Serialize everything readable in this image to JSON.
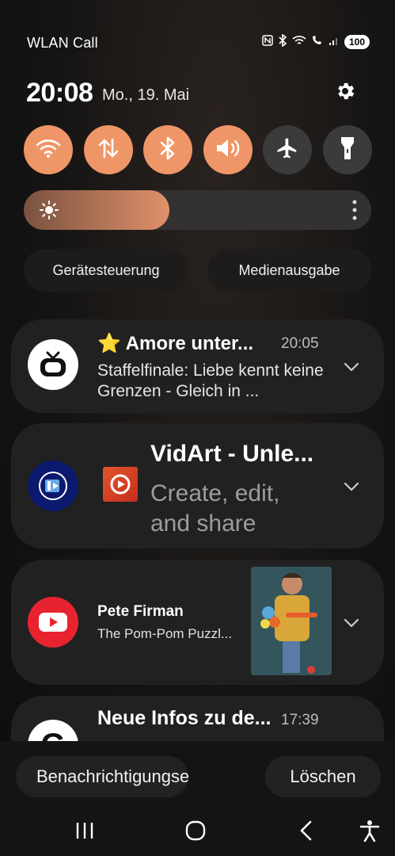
{
  "status_bar": {
    "carrier": "WLAN Call",
    "battery": "100",
    "icons": [
      "nfc-icon",
      "bluetooth-icon",
      "wifi-icon",
      "wifi-call-icon",
      "signal-icon",
      "battery-icon"
    ]
  },
  "header": {
    "time": "20:08",
    "date": "Mo., 19. Mai"
  },
  "quick_toggles": [
    {
      "name": "wifi",
      "icon": "wifi-icon",
      "on": true
    },
    {
      "name": "mobile-data",
      "icon": "data-arrows-icon",
      "on": true
    },
    {
      "name": "bluetooth",
      "icon": "bluetooth-icon",
      "on": true
    },
    {
      "name": "sound",
      "icon": "speaker-icon",
      "on": true
    },
    {
      "name": "airplane",
      "icon": "airplane-icon",
      "on": false
    },
    {
      "name": "flashlight",
      "icon": "flashlight-icon",
      "on": false
    }
  ],
  "brightness": {
    "level": 0.42
  },
  "panel_buttons": {
    "devices": "Gerätesteuerung",
    "media": "Medienausgabe"
  },
  "notifications": [
    {
      "app": "TV",
      "title": "⭐ Amore unter...",
      "time": "20:05",
      "body": "Staffelfinale: Liebe kennt keine Grenzen - Gleich in ..."
    },
    {
      "app": "VidArt",
      "title": "VidArt - Unle...",
      "body": "Create, edit, and share"
    },
    {
      "app": "YouTube",
      "title": "Pete Firman",
      "subtitle": "The Pom-Pom Puzzl..."
    },
    {
      "app": "Google",
      "title": "Neue Infos zu de...",
      "time": "17:39"
    }
  ],
  "bottom_buttons": {
    "notification_settings": "Benachrichtigungseinstellungen",
    "clear": "Löschen"
  },
  "colors": {
    "accent": "#ef9668",
    "toggle_off": "#3b3b3b",
    "card": "#222121",
    "youtube_red": "#e8232f",
    "vidart_blue": "#0b1a6e"
  }
}
